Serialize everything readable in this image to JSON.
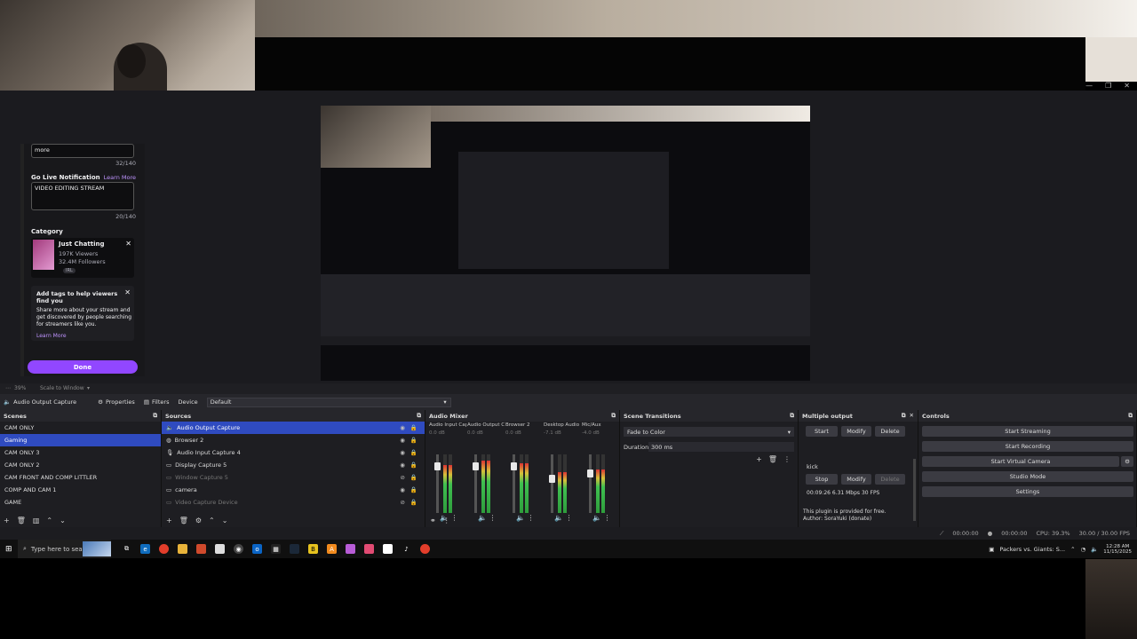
{
  "twitch_panel": {
    "title_tail": "more",
    "title_count": "32/140",
    "notification_label": "Go Live Notification",
    "learn_more": "Learn More",
    "notification_value": "VIDEO EDITING STREAM",
    "notification_count": "20/140",
    "category_label": "Category",
    "category_name": "Just Chatting",
    "category_viewers": "197K Viewers",
    "category_followers": "32.4M Followers",
    "category_tag": "IRL",
    "tags_heading": "Add tags to help viewers find you",
    "tags_body": "Share more about your stream and get discovered by people searching for streamers like you.",
    "tags_learn_more": "Learn More",
    "done_button": "Done"
  },
  "scale_bar": {
    "zoom": "39%",
    "scale_mode": "Scale to Window"
  },
  "source_toolbar": {
    "source_name": "Audio Output Capture",
    "properties": "Properties",
    "filters": "Filters",
    "device_label": "Device",
    "device_value": "Default"
  },
  "scenes": {
    "title": "Scenes",
    "items": [
      "CAM ONLY",
      "Gaming",
      "CAM ONLY 3",
      "CAM ONLY 2",
      "CAM FRONT AND COMP LITTLER",
      "COMP AND CAM 1",
      "GAME"
    ]
  },
  "sources": {
    "title": "Sources",
    "items": [
      "Audio Output Capture",
      "Browser 2",
      "Audio Input Capture 4",
      "Display Capture 5",
      "Window Capture 5",
      "camera",
      "Video Capture Device"
    ]
  },
  "mixer": {
    "title": "Audio Mixer",
    "channels": [
      {
        "name": "Audio Input Captur",
        "db": "0.0 dB",
        "level": 0.82,
        "fader": 0.85
      },
      {
        "name": "Audio Output Captu",
        "db": "0.0 dB",
        "level": 0.9,
        "fader": 0.85
      },
      {
        "name": "Browser 2",
        "db": "0.0 dB",
        "level": 0.85,
        "fader": 0.85
      },
      {
        "name": "Desktop Audio",
        "db": "-7.1 dB",
        "level": 0.7,
        "fader": 0.6
      },
      {
        "name": "Mic/Aux",
        "db": "-4.0 dB",
        "level": 0.75,
        "fader": 0.7
      }
    ],
    "scale": [
      "0",
      "-5",
      "-10",
      "-15",
      "-20",
      "-25",
      "-30",
      "-35",
      "-40",
      "-45",
      "-50",
      "-55",
      "-60"
    ]
  },
  "transitions": {
    "title": "Scene Transitions",
    "selected": "Fade to Color",
    "duration_label": "Duration",
    "duration_value": "300 ms"
  },
  "multiple_output": {
    "title": "Multiple output",
    "start": "Start",
    "modify": "Modify",
    "delete": "Delete",
    "target_name": "kick",
    "stop": "Stop",
    "stats": "00:09:26  6.31 Mbps  30 FPS",
    "plugin_note": "This plugin is provided for free.",
    "author": "Author: SoraYuki (donate)"
  },
  "controls": {
    "title": "Controls",
    "start_streaming": "Start Streaming",
    "start_recording": "Start Recording",
    "start_virtual_camera": "Start Virtual Camera",
    "studio_mode": "Studio Mode",
    "settings": "Settings"
  },
  "status_bar": {
    "stream_time": "00:00:00",
    "record_time": "00:00:00",
    "cpu": "CPU: 39.3%",
    "fps": "30.00 / 30.00 FPS"
  },
  "taskbar": {
    "search_placeholder": "Type here to search",
    "notification_text": "Packers vs. Giants: S...",
    "time": "12:28 AM",
    "date": "11/15/2025"
  },
  "colors": {
    "accent_purple": "#9147ff",
    "selection_blue": "#2f4bc0",
    "obs_panel": "#1e1e22"
  }
}
